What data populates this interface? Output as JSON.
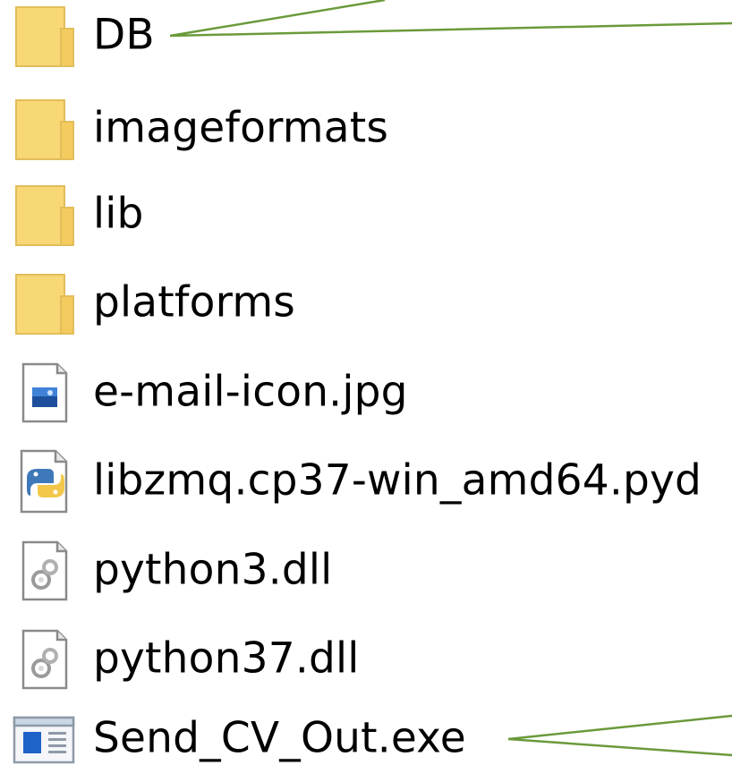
{
  "files": [
    {
      "name": "DB",
      "icon": "folder-icon"
    },
    {
      "name": "imageformats",
      "icon": "folder-icon"
    },
    {
      "name": "lib",
      "icon": "folder-icon"
    },
    {
      "name": "platforms",
      "icon": "folder-icon"
    },
    {
      "name": "e-mail-icon.jpg",
      "icon": "image-file-icon"
    },
    {
      "name": "libzmq.cp37-win_amd64.pyd",
      "icon": "python-file-icon"
    },
    {
      "name": "python3.dll",
      "icon": "dll-file-icon"
    },
    {
      "name": "python37.dll",
      "icon": "dll-file-icon"
    },
    {
      "name": "Send_CV_Out.exe",
      "icon": "exe-file-icon"
    }
  ],
  "colors": {
    "folder_fill": "#f8d775",
    "folder_edge": "#e0b44a",
    "annotation_line": "#6a9a3a",
    "text": "#000000"
  }
}
